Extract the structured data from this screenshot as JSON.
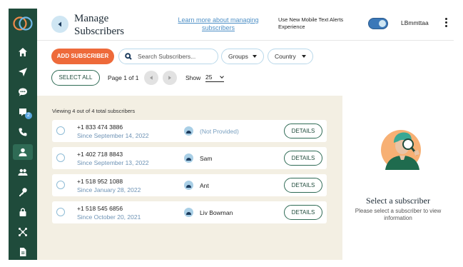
{
  "sidebar": {
    "items": [
      {
        "icon": "home-icon"
      },
      {
        "icon": "send-icon"
      },
      {
        "icon": "chat-icon"
      },
      {
        "icon": "inbox-icon",
        "badge": "2"
      },
      {
        "icon": "phone-icon"
      },
      {
        "icon": "user-icon",
        "active": true
      },
      {
        "icon": "users-icon"
      },
      {
        "icon": "key-icon"
      },
      {
        "icon": "lock-icon"
      },
      {
        "icon": "integrations-icon"
      },
      {
        "icon": "document-icon"
      }
    ]
  },
  "header": {
    "title": "Manage Subscribers",
    "learn_link": "Learn more about managing subscribers",
    "mobile_toggle_label": "Use New Mobile Text Alerts Experience",
    "mobile_toggle_on": true,
    "username": "LBmmttaa"
  },
  "toolbar": {
    "add_label": "ADD SUBSCRIBER",
    "search_placeholder": "Search Subscribers...",
    "groups_label": "Groups",
    "country_label": "Country",
    "select_all_label": "SELECT ALL",
    "page_info": "Page 1 of 1",
    "show_label": "Show",
    "show_value": "25"
  },
  "list": {
    "viewing_text": "Viewing 4 out of 4 total subscribers",
    "details_label": "DETAILS",
    "rows": [
      {
        "phone": "+1 833 474 3886",
        "since": "Since September 14, 2022",
        "name": "(Not Provided)"
      },
      {
        "phone": "+1 402 718 8843",
        "since": "Since September 13, 2022",
        "name": "Sam"
      },
      {
        "phone": "+1 518 952 1088",
        "since": "Since January 28, 2022",
        "name": "Ant"
      },
      {
        "phone": "+1 518 545 6856",
        "since": "Since October 20, 2021",
        "name": "Liv Bowman"
      }
    ]
  },
  "detail_panel": {
    "title": "Select a subscriber",
    "subtitle": "Please select a subscriber to view information"
  },
  "colors": {
    "sidebar": "#1f4b3b",
    "accent_orange": "#ee6a3a",
    "list_background": "#f3efe3",
    "link_blue": "#4d8fc6"
  }
}
